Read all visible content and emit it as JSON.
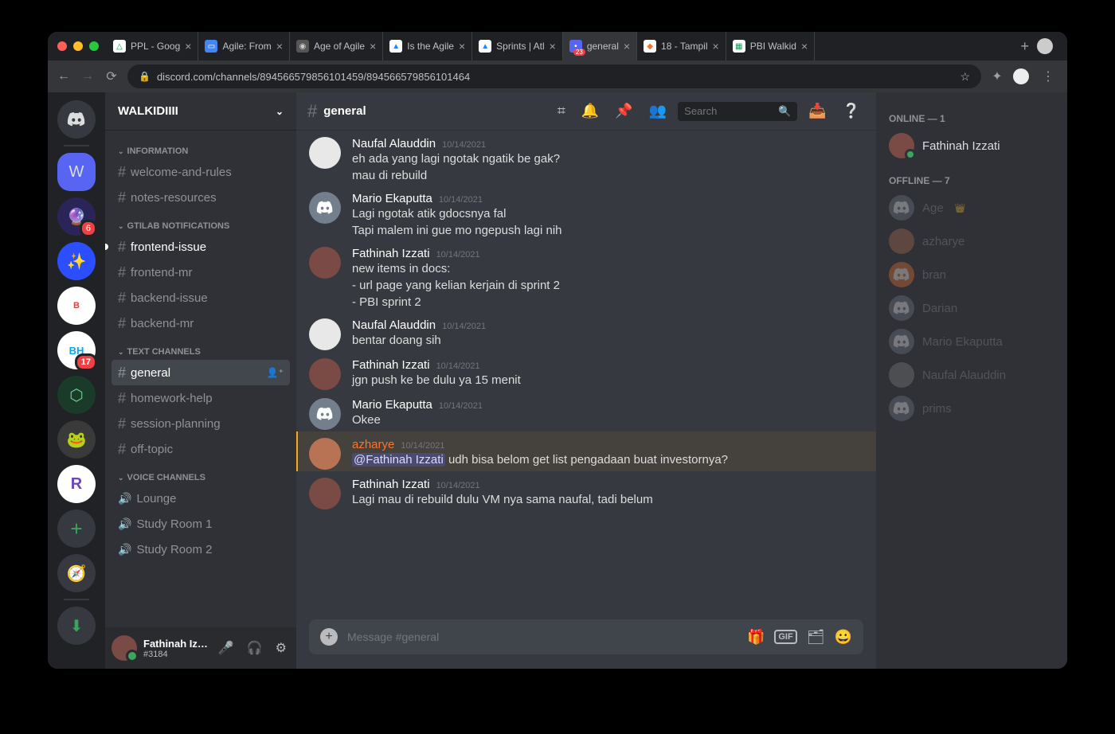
{
  "browser": {
    "tabs": [
      {
        "label": "PPL - Goog",
        "favicon_bg": "#fff",
        "favicon_txt": "△",
        "favicon_color": "#0f9d58"
      },
      {
        "label": "Agile: From",
        "favicon_bg": "#4285f4",
        "favicon_txt": "▭",
        "favicon_color": "#fff"
      },
      {
        "label": "Age of Agile",
        "favicon_bg": "#555",
        "favicon_txt": "◉",
        "favicon_color": "#ccc"
      },
      {
        "label": "Is the Agile",
        "favicon_bg": "#fff",
        "favicon_txt": "▲",
        "favicon_color": "#2684ff"
      },
      {
        "label": "Sprints | Atl",
        "favicon_bg": "#fff",
        "favicon_txt": "▲",
        "favicon_color": "#2684ff"
      },
      {
        "label": "general",
        "favicon_bg": "#5865f2",
        "favicon_txt": "•",
        "favicon_color": "#fff",
        "active": true,
        "badge": "23"
      },
      {
        "label": "18 - Tampil",
        "favicon_bg": "#fff",
        "favicon_txt": "◆",
        "favicon_color": "#fc6d26"
      },
      {
        "label": "PBI Walkid",
        "favicon_bg": "#fff",
        "favicon_txt": "▦",
        "favicon_color": "#0f9d58"
      }
    ],
    "url": "discord.com/channels/894566579856101459/894566579856101464"
  },
  "server": {
    "name": "WALKIDIIII",
    "categories": [
      {
        "name": "INFORMATION",
        "channels": [
          {
            "name": "welcome-and-rules",
            "type": "text"
          },
          {
            "name": "notes-resources",
            "type": "text"
          }
        ]
      },
      {
        "name": "GTILAB NOTIFICATIONS",
        "channels": [
          {
            "name": "frontend-issue",
            "type": "text",
            "unread": true
          },
          {
            "name": "frontend-mr",
            "type": "text"
          },
          {
            "name": "backend-issue",
            "type": "text"
          },
          {
            "name": "backend-mr",
            "type": "text"
          }
        ]
      },
      {
        "name": "TEXT CHANNELS",
        "channels": [
          {
            "name": "general",
            "type": "text",
            "selected": true
          },
          {
            "name": "homework-help",
            "type": "text"
          },
          {
            "name": "session-planning",
            "type": "text"
          },
          {
            "name": "off-topic",
            "type": "text"
          }
        ]
      },
      {
        "name": "VOICE CHANNELS",
        "channels": [
          {
            "name": "Lounge",
            "type": "voice"
          },
          {
            "name": "Study Room 1",
            "type": "voice"
          },
          {
            "name": "Study Room 2",
            "type": "voice"
          }
        ]
      }
    ]
  },
  "current_channel": "general",
  "user": {
    "name": "Fathinah Izz...",
    "tag": "#3184"
  },
  "messages": [
    {
      "author": "Naufal Alauddin",
      "ts": "10/14/2021",
      "avatar": "line",
      "lines": [
        "eh ada yang lagi ngotak ngatik be gak?",
        "mau di rebuild"
      ]
    },
    {
      "author": "Mario Ekaputta",
      "ts": "10/14/2021",
      "avatar": "gray",
      "lines": [
        "Lagi ngotak atik gdocsnya fal",
        "Tapi malem ini gue mo ngepush lagi nih"
      ]
    },
    {
      "author": "Fathinah Izzati",
      "ts": "10/14/2021",
      "avatar": "hijab",
      "lines": [
        "new items in docs:",
        "- url page yang kelian kerjain di sprint 2",
        "- PBI sprint 2"
      ]
    },
    {
      "author": "Naufal Alauddin",
      "ts": "10/14/2021",
      "avatar": "line",
      "lines": [
        "bentar doang sih"
      ]
    },
    {
      "author": "Fathinah Izzati",
      "ts": "10/14/2021",
      "avatar": "hijab",
      "lines": [
        "jgn push ke be dulu ya 15 menit"
      ]
    },
    {
      "author": "Mario Ekaputta",
      "ts": "10/14/2021",
      "avatar": "gray",
      "lines": [
        "Okee"
      ]
    },
    {
      "author": "azharye",
      "ts": "10/14/2021",
      "avatar": "az",
      "highlight": true,
      "mention": "@Fathinah Izzati",
      "after_mention": " udh bisa belom get list pengadaan buat investornya?"
    },
    {
      "author": "Fathinah Izzati",
      "ts": "10/14/2021",
      "avatar": "hijab",
      "lines": [
        "Lagi mau di rebuild dulu  VM nya sama naufal, tadi belum"
      ]
    }
  ],
  "input_placeholder": "Message #general",
  "search_placeholder": "Search",
  "members": {
    "online_label": "ONLINE — 1",
    "online": [
      {
        "name": "Fathinah Izzati",
        "avatar": "hijab"
      }
    ],
    "offline_label": "OFFLINE — 7",
    "offline": [
      {
        "name": "Age",
        "crown": true,
        "avatar": "gray"
      },
      {
        "name": "azharye",
        "avatar": "az"
      },
      {
        "name": "bran",
        "avatar": "orange"
      },
      {
        "name": "Darian",
        "avatar": "gray"
      },
      {
        "name": "Mario Ekaputta",
        "avatar": "gray"
      },
      {
        "name": "Naufal Alauddin",
        "avatar": "line"
      },
      {
        "name": "prims",
        "avatar": "gray"
      }
    ]
  },
  "rail_badges": {
    "srv2": "6",
    "srv5": "17"
  }
}
